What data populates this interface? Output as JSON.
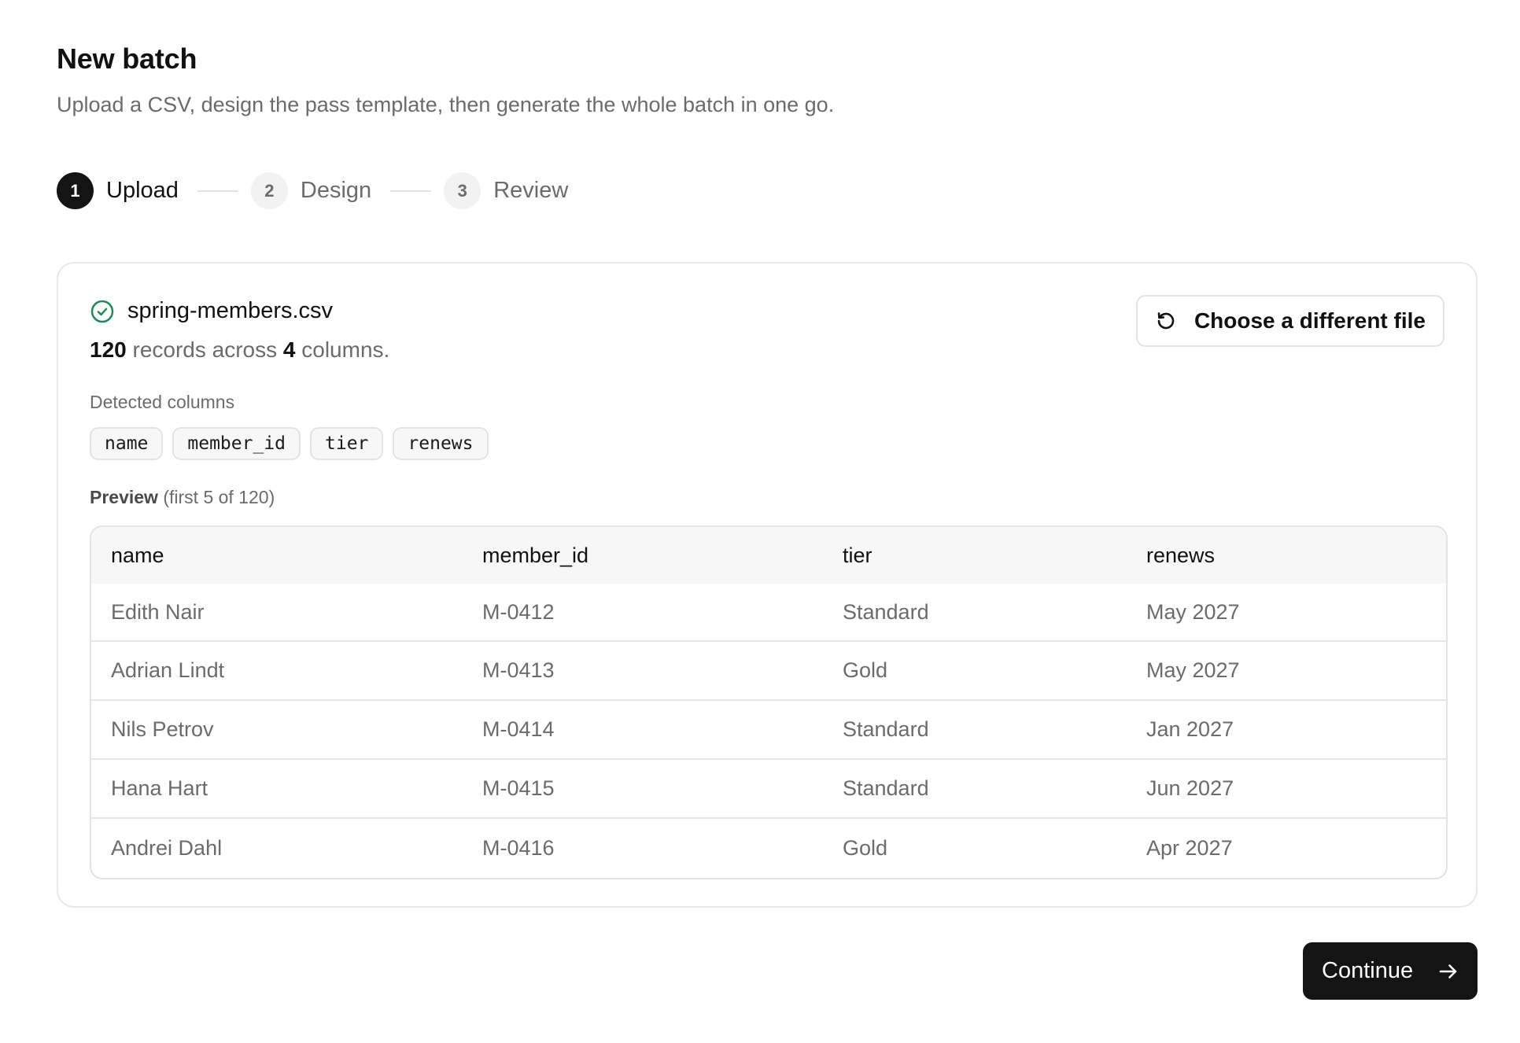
{
  "header": {
    "title": "New batch",
    "subtitle": "Upload a CSV, design the pass template, then generate the whole batch in one go."
  },
  "stepper": {
    "steps": [
      {
        "number": "1",
        "label": "Upload",
        "active": true
      },
      {
        "number": "2",
        "label": "Design",
        "active": false
      },
      {
        "number": "3",
        "label": "Review",
        "active": false
      }
    ]
  },
  "upload": {
    "file_name": "spring-members.csv",
    "record_count": "120",
    "records_text": "records across",
    "column_count": "4",
    "columns_text": "columns.",
    "change_button_label": "Choose a different file",
    "detected_columns_label": "Detected columns",
    "detected_columns": [
      "name",
      "member_id",
      "tier",
      "renews"
    ],
    "preview_label_strong": "Preview",
    "preview_label_rest": "(first 5 of 120)"
  },
  "table": {
    "headers": [
      "name",
      "member_id",
      "tier",
      "renews"
    ],
    "rows": [
      [
        "Edith Nair",
        "M-0412",
        "Standard",
        "May 2027"
      ],
      [
        "Adrian Lindt",
        "M-0413",
        "Gold",
        "May 2027"
      ],
      [
        "Nils Petrov",
        "M-0414",
        "Standard",
        "Jan 2027"
      ],
      [
        "Hana Hart",
        "M-0415",
        "Standard",
        "Jun 2027"
      ],
      [
        "Andrei Dahl",
        "M-0416",
        "Gold",
        "Apr 2027"
      ]
    ]
  },
  "footer": {
    "continue_label": "Continue"
  },
  "icons": {
    "success": "check-circle-icon",
    "refresh": "refresh-icon",
    "continue": "arrow-right-icon"
  },
  "colors": {
    "success": "#1f8a5e",
    "primary": "#141414"
  }
}
